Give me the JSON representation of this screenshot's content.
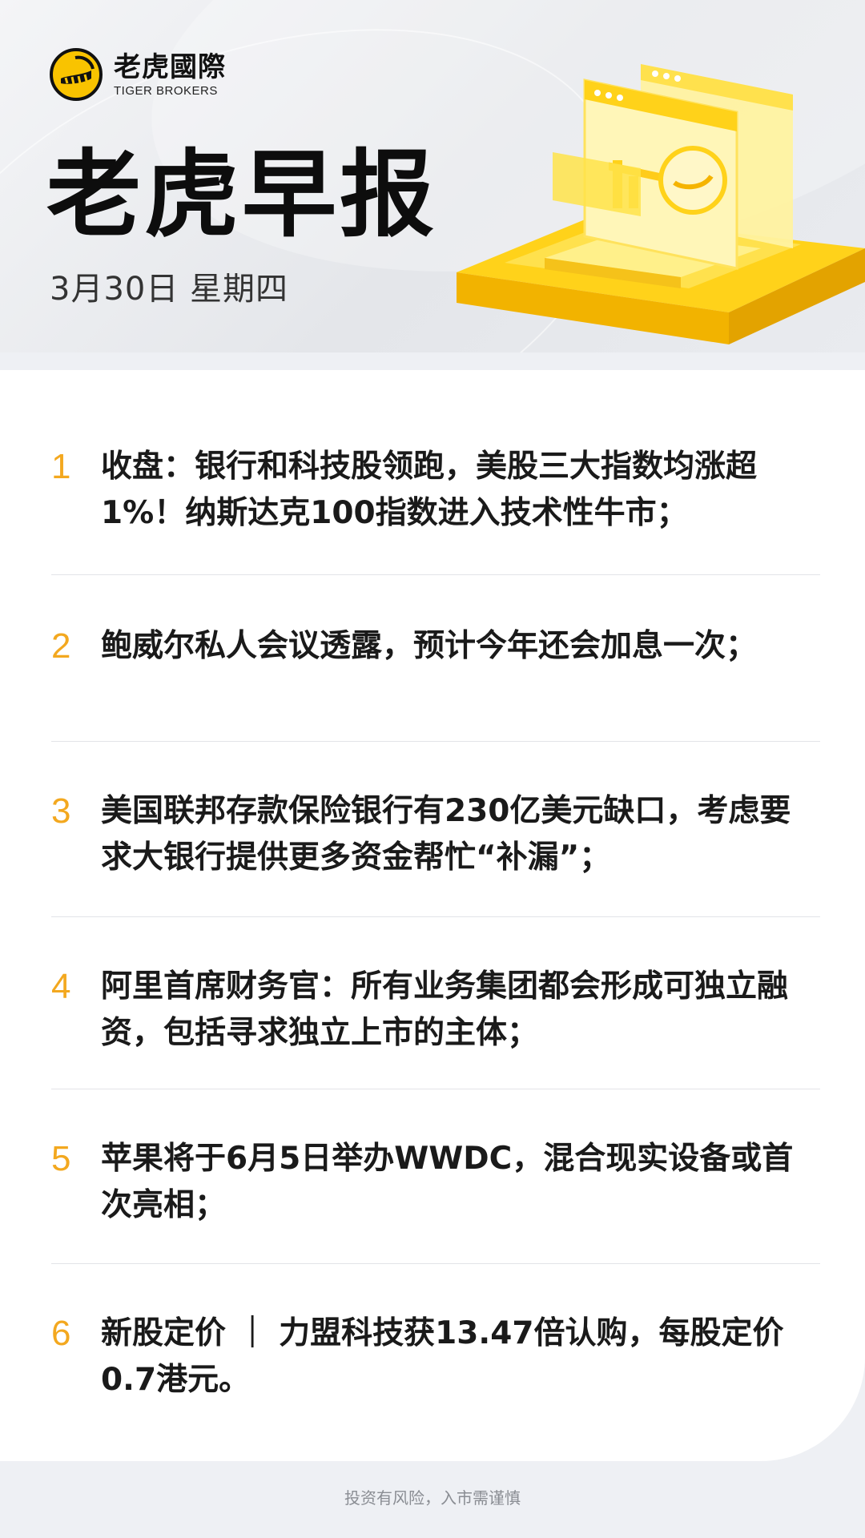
{
  "brand": {
    "name_cn": "老虎國際",
    "name_en": "TIGER BROKERS",
    "logo_icon": "tiger-logo-icon",
    "accent_color": "#f9c300"
  },
  "header": {
    "title": "老虎早报",
    "date": "3月30日 星期四",
    "illustration": "gold-platform-illustration"
  },
  "news": [
    {
      "num": "1",
      "text": "收盘：银行和科技股领跑，美股三大指数均涨超1%！纳斯达克100指数进入技术性牛市；"
    },
    {
      "num": "2",
      "text": "鲍威尔私人会议透露，预计今年还会加息一次；"
    },
    {
      "num": "3",
      "text": "美国联邦存款保险银行有230亿美元缺口，考虑要求大银行提供更多资金帮忙“补漏”；"
    },
    {
      "num": "4",
      "text": "阿里首席财务官：所有业务集团都会形成可独立融资，包括寻求独立上市的主体；"
    },
    {
      "num": "5",
      "text": "苹果将于6月5日举办WWDC，混合现实设备或首次亮相；"
    },
    {
      "num": "6",
      "text": "新股定价 ｜ 力盟科技获13.47倍认购，每股定价0.7港元。"
    }
  ],
  "footer": {
    "disclaimer": "投资有风险，入市需谨慎"
  },
  "colors": {
    "number": "#f3a81f",
    "text": "#1a1a1a",
    "divider": "#e2e4e8"
  }
}
